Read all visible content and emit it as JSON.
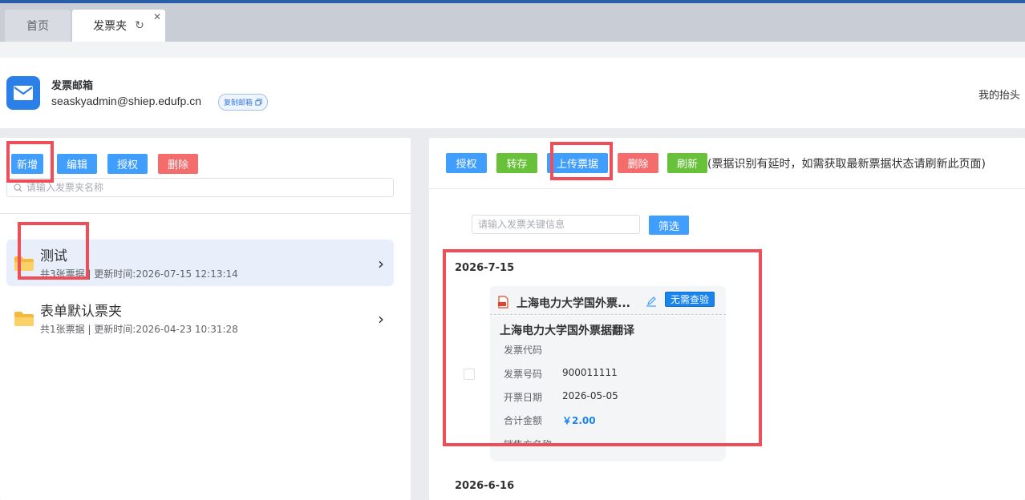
{
  "tabs": [
    {
      "label": "首页"
    },
    {
      "label": "发票夹"
    }
  ],
  "mailbox": {
    "title": "发票邮箱",
    "address": "seaskyadmin@shiep.edufp.cn",
    "copy_label": "复制邮箱",
    "right_label": "我的抬头"
  },
  "left_toolbar": {
    "add": "新增",
    "edit": "编辑",
    "authorize": "授权",
    "delete": "删除"
  },
  "folder_search": {
    "placeholder": "请输入发票夹名称"
  },
  "folders": [
    {
      "name": "测试",
      "meta": "共3张票据 | 更新时间:2026-07-15 12:13:14",
      "selected": true
    },
    {
      "name": "表单默认票夹",
      "meta": "共1张票据 | 更新时间:2026-04-23 10:31:28",
      "selected": false
    }
  ],
  "right_toolbar": {
    "authorize": "授权",
    "transfer": "转存",
    "upload": "上传票据",
    "delete": "删除",
    "refresh": "刷新",
    "note": "(票据识别有延时，如需获取最新票据状态请刷新此页面)"
  },
  "filter": {
    "placeholder": "请输入发票关键信息",
    "button": "筛选"
  },
  "groups": [
    {
      "date": "2026-7-15",
      "invoice": {
        "header_title": "上海电力大学国外票...",
        "badge": "无需查验",
        "title": "上海电力大学国外票据翻译",
        "fields": [
          {
            "label": "发票代码",
            "value": ""
          },
          {
            "label": "发票号码",
            "value": "900011111"
          },
          {
            "label": "开票日期",
            "value": "2026-05-05"
          },
          {
            "label": "合计金额",
            "value": "￥2.00"
          },
          {
            "label": "销售方名称",
            "value": ""
          }
        ]
      }
    },
    {
      "date": "2026-6-16"
    }
  ],
  "colors": {
    "primary": "#409eff",
    "danger": "#f56c6c",
    "success": "#67c23a",
    "highlight_box": "#ef4d57",
    "top_bar": "#2a5da8"
  }
}
